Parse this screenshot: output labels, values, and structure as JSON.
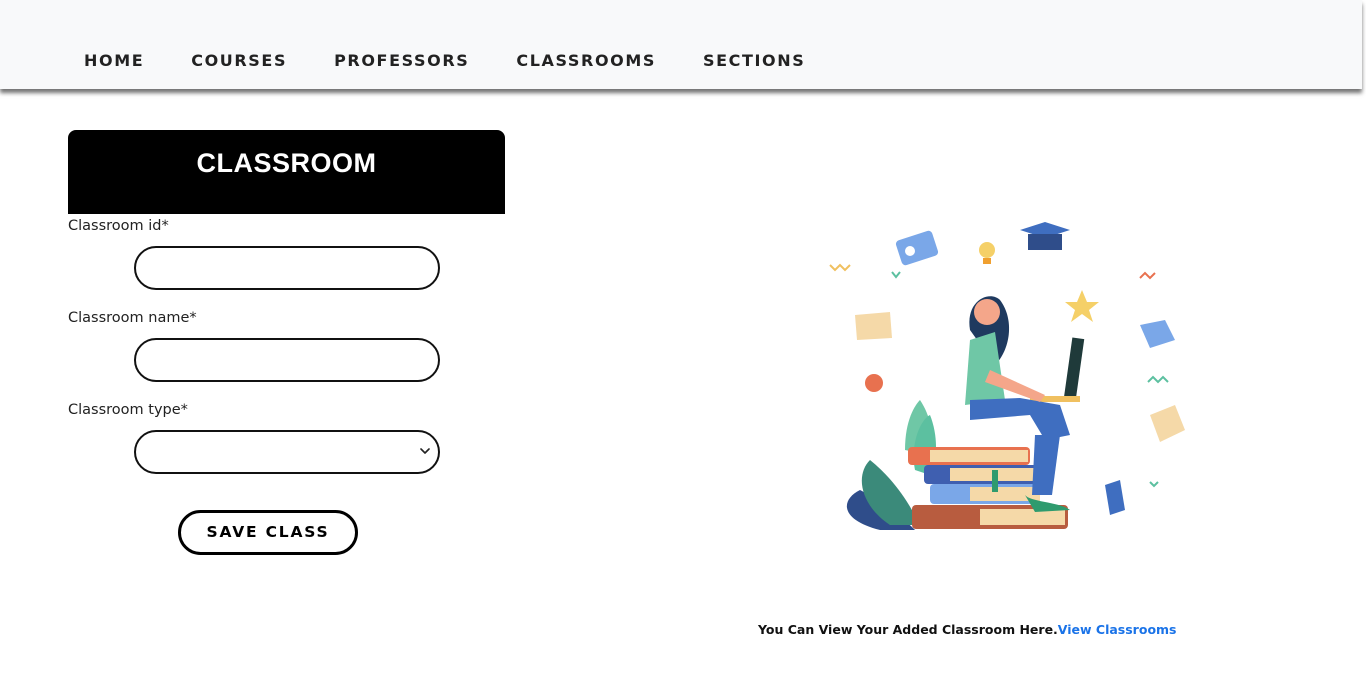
{
  "nav": {
    "items": [
      {
        "label": "HOME"
      },
      {
        "label": "COURSES"
      },
      {
        "label": "PROFESSORS"
      },
      {
        "label": "CLASSROOMS"
      },
      {
        "label": "SECTIONS"
      }
    ]
  },
  "form": {
    "title": "CLASSROOM",
    "classroom_id": {
      "label": "Classroom id*",
      "value": ""
    },
    "classroom_name": {
      "label": "Classroom name*",
      "value": ""
    },
    "classroom_type": {
      "label": "Classroom type*",
      "selected": ""
    },
    "save_label": "SAVE CLASS"
  },
  "footer": {
    "text": "You Can View Your Added Classroom Here.",
    "link_label": "View Classrooms"
  },
  "colors": {
    "accent_link": "#1a73e8",
    "header_bg": "#000000",
    "navbar_bg": "#f8f9fa"
  },
  "illustration": {
    "name": "student-studying-illustration"
  }
}
